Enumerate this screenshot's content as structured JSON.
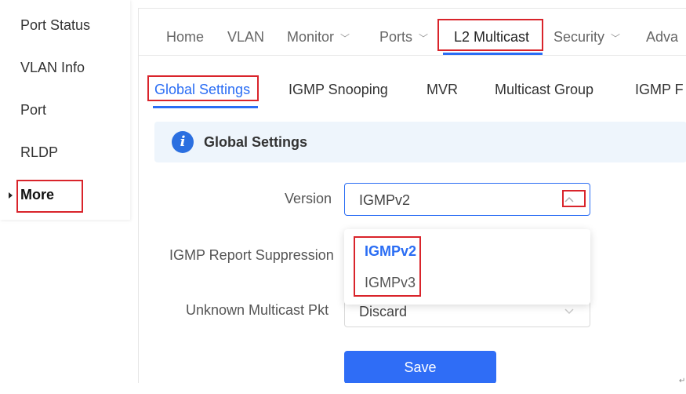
{
  "sidebar": {
    "items": [
      {
        "label": "Port Status"
      },
      {
        "label": "VLAN Info"
      },
      {
        "label": "Port"
      },
      {
        "label": "RLDP"
      },
      {
        "label": "More"
      }
    ]
  },
  "topnav": {
    "items": [
      {
        "label": "Home"
      },
      {
        "label": "VLAN"
      },
      {
        "label": "Monitor"
      },
      {
        "label": "Ports"
      },
      {
        "label": "L2 Multicast"
      },
      {
        "label": "Security"
      },
      {
        "label": "Adva"
      }
    ],
    "active": "L2 Multicast"
  },
  "subtabs": {
    "items": [
      {
        "label": "Global Settings"
      },
      {
        "label": "IGMP Snooping"
      },
      {
        "label": "MVR"
      },
      {
        "label": "Multicast Group"
      },
      {
        "label": "IGMP F"
      }
    ],
    "active": "Global Settings"
  },
  "section": {
    "title": "Global Settings",
    "icon": "info-icon"
  },
  "form": {
    "version": {
      "label": "Version",
      "value": "IGMPv2",
      "options": [
        "IGMPv2",
        "IGMPv3"
      ],
      "selected": "IGMPv2"
    },
    "report_suppression": {
      "label": "IGMP Report Suppression"
    },
    "unknown_multicast": {
      "label": "Unknown Multicast Pkt",
      "value": "Discard"
    }
  },
  "actions": {
    "save_label": "Save"
  },
  "colors": {
    "accent": "#2a6df4",
    "highlight_box": "#d9242b",
    "section_bg": "#eef5fc"
  },
  "doc_mark": "↵"
}
